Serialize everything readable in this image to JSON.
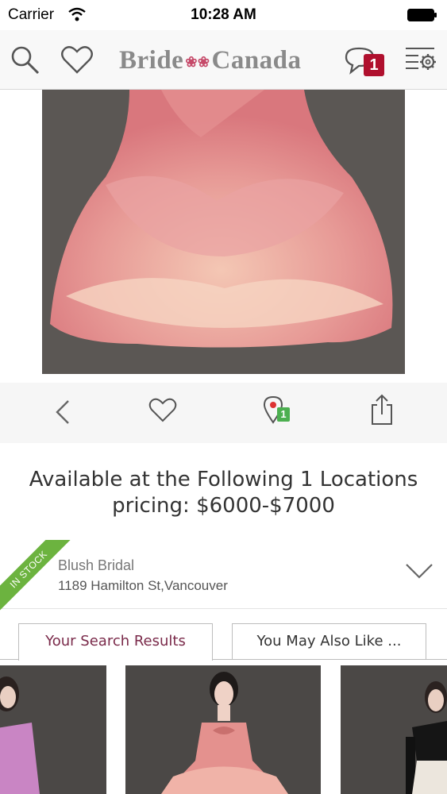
{
  "status": {
    "carrier": "Carrier",
    "time": "10:28 AM"
  },
  "header": {
    "logo_left": "Bride",
    "logo_right": "Canada",
    "logo_flower": "❀❀",
    "messages_badge": "1",
    "icons": [
      "search-icon",
      "heart-icon",
      "chat-icon",
      "settings-menu-icon"
    ]
  },
  "actions": {
    "icons": [
      "back-chevron-icon",
      "heart-icon",
      "location-pin-icon",
      "share-icon"
    ],
    "location_badge": "1"
  },
  "availability": {
    "line1": "Available at the Following 1 Locations",
    "line2": "pricing: $6000-$7000"
  },
  "location": {
    "ribbon": "IN STOCK",
    "name": "Blush Bridal",
    "address": "1189 Hamilton St,Vancouver"
  },
  "tabs": {
    "active": "Your Search Results",
    "inactive": "You May Also Like ..."
  },
  "colors": {
    "accent": "#7a2a4a",
    "badge": "#b0102e",
    "stock": "#6cb33f"
  }
}
